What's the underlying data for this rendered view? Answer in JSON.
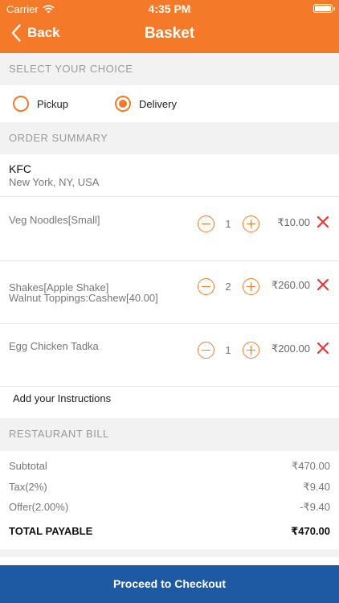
{
  "status_bar": {
    "carrier": "Carrier",
    "time": "4:35 PM"
  },
  "nav": {
    "back_label": "Back",
    "title": "Basket"
  },
  "choice": {
    "section_label": "SELECT YOUR CHOICE",
    "options": [
      {
        "label": "Pickup",
        "selected": false
      },
      {
        "label": "Delivery",
        "selected": true
      }
    ]
  },
  "order": {
    "section_label": "ORDER SUMMARY",
    "restaurant": {
      "name": "KFC",
      "address": "New York, NY, USA"
    },
    "items": [
      {
        "name_line1": "Veg Noodles[Small]",
        "name_line2": "",
        "qty": "1",
        "price": "₹10.00"
      },
      {
        "name_line1": "Shakes[Apple Shake]",
        "name_line2": "Walnut Toppings:Cashew[40.00]",
        "qty": "2",
        "price": "₹260.00"
      },
      {
        "name_line1": "Egg Chicken Tadka",
        "name_line2": "",
        "qty": "1",
        "price": "₹200.00"
      }
    ],
    "instructions_label": "Add your Instructions"
  },
  "bill": {
    "section_label": "RESTAURANT BILL",
    "rows": [
      {
        "label": "Subtotal",
        "value": "₹470.00"
      },
      {
        "label": "Tax(2%)",
        "value": "₹9.40"
      },
      {
        "label": "Offer(2.00%)",
        "value": "-₹9.40"
      }
    ],
    "total": {
      "label": "TOTAL PAYABLE",
      "value": "₹470.00"
    }
  },
  "checkout": {
    "label": "Proceed to Checkout"
  },
  "colors": {
    "accent": "#f47a2a",
    "checkout": "#1e5aa3",
    "remove": "#e53935"
  }
}
